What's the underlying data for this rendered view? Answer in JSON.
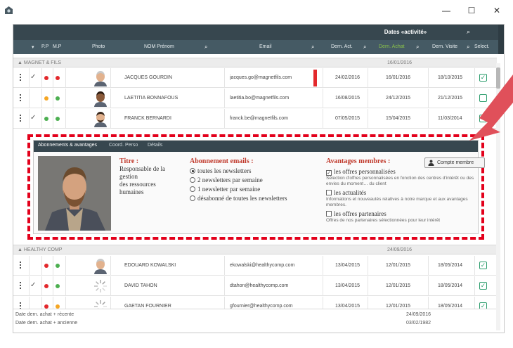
{
  "window": {
    "minimize": "—",
    "maximize": "☐",
    "close": "✕"
  },
  "header": {
    "dates_title": "Dates «activité»",
    "columns": {
      "pp": "P.P",
      "mp": "M.P",
      "photo": "Photo",
      "name": "NOM Prénom",
      "email": "Email",
      "dern_act": "Dern. Act.",
      "dern_achat": "Dern. Achat",
      "dern_visite": "Dern. Visite",
      "select": "Select."
    }
  },
  "groups": [
    {
      "name": "MAGNET & FILS",
      "date": "16/01/2016",
      "rows": [
        {
          "check": "✓",
          "dot1": "#e3282c",
          "dot2": "#e3282c",
          "avatar": "person-light",
          "name": "JACQUES GOURDIN",
          "email": "jacques.go@magnetfils.com",
          "dern_act": "24/02/2016",
          "dern_achat": "16/01/2016",
          "dern_visite": "18/10/2015",
          "selected": true,
          "marker": true
        },
        {
          "check": "",
          "dot1": "#f5a623",
          "dot2": "#4caf50",
          "avatar": "person-dark",
          "name": "LAETITIA BONNAFOUS",
          "email": "laetitia.bo@magnetfils.com",
          "dern_act": "16/08/2015",
          "dern_achat": "24/12/2015",
          "dern_visite": "21/12/2015",
          "selected": false,
          "marker": false
        },
        {
          "check": "✓",
          "dot1": "#4caf50",
          "dot2": "#4caf50",
          "avatar": "person-beard",
          "name": "FRANCK BERNARDI",
          "email": "franck.be@magnetfils.com",
          "dern_act": "07/05/2015",
          "dern_achat": "15/04/2015",
          "dern_visite": "11/03/2014",
          "selected": false,
          "marker": false
        }
      ]
    },
    {
      "name": "HEALTHY COMP",
      "date": "24/09/2016",
      "rows": [
        {
          "check": "",
          "dot1": "#e3282c",
          "dot2": "#4caf50",
          "avatar": "person-light",
          "name": "EDOUARD KOWALSKI",
          "email": "ekowalski@healthycomp.com",
          "dern_act": "13/04/2015",
          "dern_achat": "12/01/2015",
          "dern_visite": "18/05/2014",
          "selected": true,
          "marker": false
        },
        {
          "check": "✓",
          "dot1": "#e3282c",
          "dot2": "#4caf50",
          "avatar": "spinner",
          "name": "DAVID TAHON",
          "email": "dtahon@healthycomp.com",
          "dern_act": "13/04/2015",
          "dern_achat": "12/01/2015",
          "dern_visite": "18/05/2014",
          "selected": true,
          "marker": false
        },
        {
          "check": "",
          "dot1": "#e3282c",
          "dot2": "#f5a623",
          "avatar": "spinner",
          "name": "GAETAN FOURNIER",
          "email": "gfournier@healthycomp.com",
          "dern_act": "13/04/2015",
          "dern_achat": "12/01/2015",
          "dern_visite": "18/05/2014",
          "selected": true,
          "marker": false
        }
      ]
    }
  ],
  "detail": {
    "tabs": [
      "Abonnements & avantages",
      "Coord. Perso",
      "Détails"
    ],
    "titre_label": "Titre :",
    "titre_lines": [
      "Responsable de la",
      "gestion",
      "des ressources",
      "humaines"
    ],
    "abonnement_label": "Abonnement emails :",
    "abonnement_options": [
      {
        "label": "toutes les newsletters",
        "checked": true
      },
      {
        "label": "2 newsletters par semaine",
        "checked": false
      },
      {
        "label": "1 newsletter par semaine",
        "checked": false
      },
      {
        "label": "désabonné de toutes les newsletters",
        "checked": false
      }
    ],
    "avantages_label": "Avantages membres :",
    "member_button": "Compte membre",
    "avantages": [
      {
        "label": "les offres personnalisées",
        "checked": true,
        "desc": "Sélection d'offres personnalisées en fonction des centres d'intérêt ou des envies du moment… du client"
      },
      {
        "label": "les actualités",
        "checked": false,
        "desc": "Informations et nouveautés relatives à notre marque et aux avantages membres."
      },
      {
        "label": "les offres partenaires",
        "checked": false,
        "desc": "Offres de nos partenaires sélectionnées pour leur intérêt"
      }
    ]
  },
  "footer": {
    "line1": "Date dern. achat + récente",
    "line2": "Date dern. achat + ancienne",
    "date1": "24/09/2016",
    "date2": "03/02/1982"
  }
}
